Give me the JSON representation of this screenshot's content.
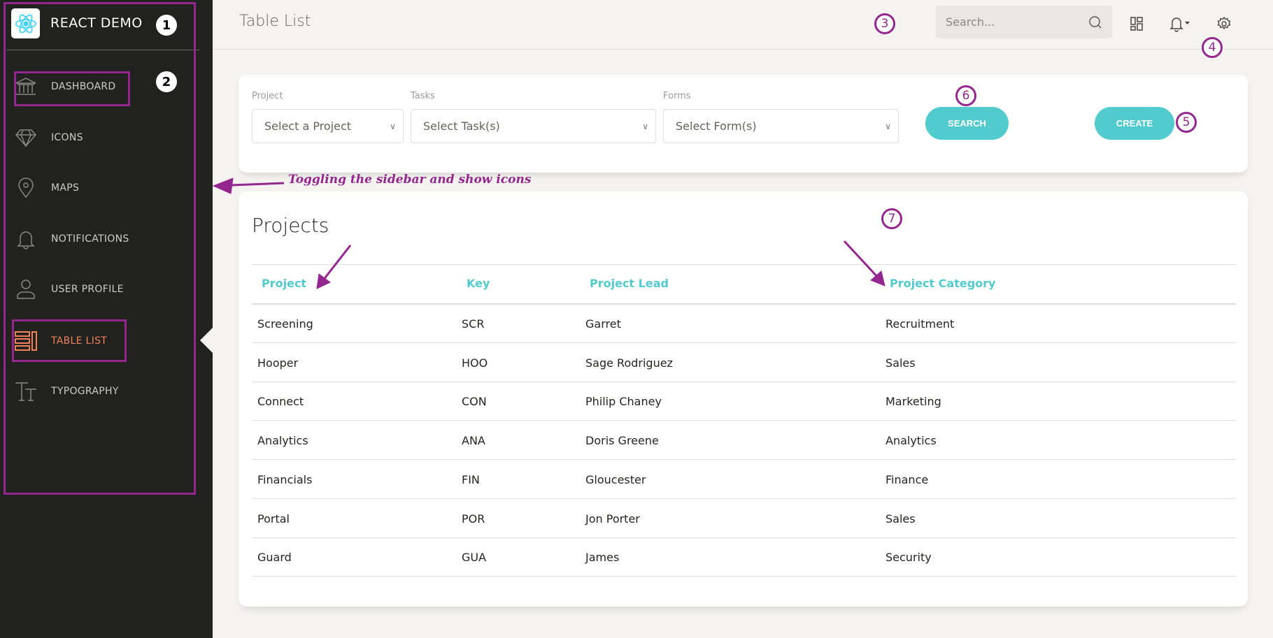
{
  "sidebar": {
    "brand": "REACT DEMO",
    "items": [
      {
        "label": "DASHBOARD",
        "icon": "bank-icon"
      },
      {
        "label": "ICONS",
        "icon": "diamond-icon"
      },
      {
        "label": "MAPS",
        "icon": "map-pin-icon"
      },
      {
        "label": "NOTIFICATIONS",
        "icon": "bell-icon"
      },
      {
        "label": "USER PROFILE",
        "icon": "user-icon"
      },
      {
        "label": "TABLE LIST",
        "icon": "table-list-icon",
        "active": true
      },
      {
        "label": "TYPOGRAPHY",
        "icon": "typography-icon"
      }
    ]
  },
  "header": {
    "title": "Table List",
    "search_placeholder": "Search..."
  },
  "filters": {
    "project_label": "Project",
    "project_value": "Select a Project",
    "tasks_label": "Tasks",
    "tasks_value": "Select Task(s)",
    "forms_label": "Forms",
    "forms_value": "Select Form(s)",
    "search_button": "SEARCH",
    "create_button": "CREATE"
  },
  "table": {
    "title": "Projects",
    "columns": [
      "Project",
      "Key",
      "Project Lead",
      "Project Category"
    ],
    "rows": [
      [
        "Screening",
        "SCR",
        "Garret",
        "Recruitment"
      ],
      [
        "Hooper",
        "HOO",
        "Sage Rodriguez",
        "Sales"
      ],
      [
        "Connect",
        "CON",
        "Philip Chaney",
        "Marketing"
      ],
      [
        "Analytics",
        "ANA",
        "Doris Greene",
        "Analytics"
      ],
      [
        "Financials",
        "FIN",
        "Gloucester",
        "Finance"
      ],
      [
        "Portal",
        "POR",
        "Jon Porter",
        "Sales"
      ],
      [
        "Guard",
        "GUA",
        "James",
        "Security"
      ]
    ]
  },
  "annotations": {
    "note": "Toggling the sidebar and show icons",
    "markers": [
      "1",
      "2",
      "3",
      "4",
      "5",
      "6",
      "7"
    ]
  },
  "colors": {
    "accent": "#51cbce",
    "active": "#ef8157",
    "annotation": "#93278f",
    "sidebar": "#212120"
  }
}
